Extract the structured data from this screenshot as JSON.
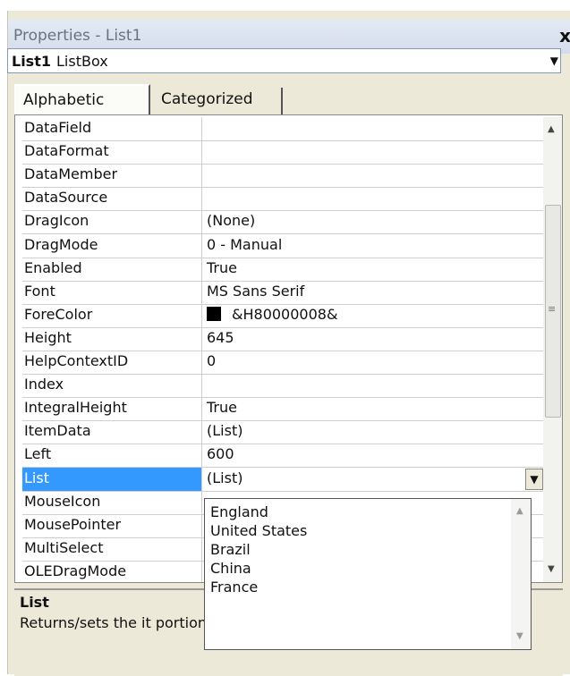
{
  "window": {
    "title": "Properties - List1",
    "close_glyph": "x"
  },
  "object_selector": {
    "name": "List1",
    "type": "ListBox",
    "dropdown_glyph": "▼"
  },
  "tabs": [
    {
      "label": "Alphabetic",
      "active": true
    },
    {
      "label": "Categorized",
      "active": false
    }
  ],
  "properties": [
    {
      "name": "DataField",
      "value": ""
    },
    {
      "name": "DataFormat",
      "value": ""
    },
    {
      "name": "DataMember",
      "value": ""
    },
    {
      "name": "DataSource",
      "value": ""
    },
    {
      "name": "DragIcon",
      "value": "(None)"
    },
    {
      "name": "DragMode",
      "value": "0 - Manual"
    },
    {
      "name": "Enabled",
      "value": "True"
    },
    {
      "name": "Font",
      "value": "MS Sans Serif"
    },
    {
      "name": "ForeColor",
      "value": "&H80000008&",
      "swatch": "#000000"
    },
    {
      "name": "Height",
      "value": "645"
    },
    {
      "name": "HelpContextID",
      "value": "0"
    },
    {
      "name": "Index",
      "value": ""
    },
    {
      "name": "IntegralHeight",
      "value": "True"
    },
    {
      "name": "ItemData",
      "value": "(List)"
    },
    {
      "name": "Left",
      "value": "600"
    },
    {
      "name": "List",
      "value": "(List)",
      "selected": true,
      "has_dropdown": true
    },
    {
      "name": "MouseIcon",
      "value": ""
    },
    {
      "name": "MousePointer",
      "value": ""
    },
    {
      "name": "MultiSelect",
      "value": ""
    },
    {
      "name": "OLEDragMode",
      "value": ""
    }
  ],
  "list_dropdown": {
    "items": [
      "England",
      "United States",
      "Brazil",
      "China",
      "France"
    ]
  },
  "description": {
    "title": "List",
    "text": "Returns/sets the it portion."
  },
  "colors": {
    "selection": "#3399ff",
    "panel": "#ece9d8"
  }
}
